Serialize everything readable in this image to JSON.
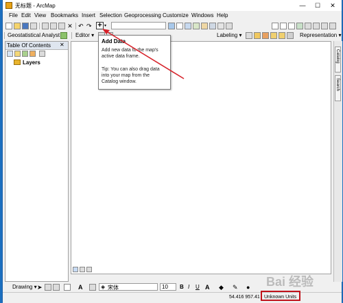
{
  "window": {
    "title": "无标题 - ArcMap"
  },
  "menu": [
    "File",
    "Edit",
    "View",
    "Bookmarks",
    "Insert",
    "Selection",
    "Geoprocessing",
    "Customize",
    "Windows",
    "Help"
  ],
  "toolbar2": {
    "geostat_label": "Geostatistical Analyst ▾",
    "editor_label": "Editor ▾",
    "labeling_label": "Labeling ▾",
    "representation_label": "Representation ▾"
  },
  "toc": {
    "title": "Table Of Contents",
    "layers_label": "Layers"
  },
  "tooltip": {
    "title": "Add Data",
    "body": "Add new data to the map's active data frame.",
    "tip": "Tip: You can also drag data into your map from the Catalog window."
  },
  "right_tabs": [
    "Catalog",
    "Search"
  ],
  "drawing": {
    "drawing_label": "Drawing ▾",
    "font_name": "宋体",
    "font_size": "10",
    "bold": "B",
    "italic": "I",
    "underline": "U"
  },
  "status": {
    "coords": "54.416  957.41",
    "units": "Unknown Units"
  },
  "watermark": "Bai 经验",
  "colors": {
    "accent": "#c0111a",
    "titlebar": "#ffffff",
    "frame": "#1c6fbf"
  }
}
